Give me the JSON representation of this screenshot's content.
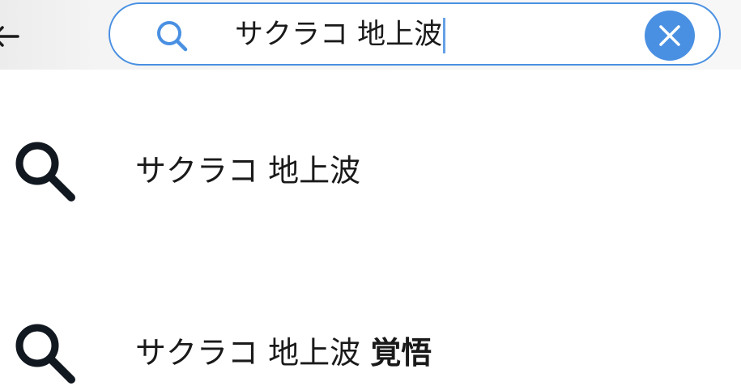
{
  "header": {
    "back_icon": "arrow-left-icon",
    "search": {
      "icon": "search-icon",
      "value": "サクラコ 地上波",
      "clear_icon": "close-icon",
      "accent_color": "#4a90e2"
    }
  },
  "suggestions": [
    {
      "icon": "search-icon",
      "text": "サクラコ 地上波",
      "bold": ""
    },
    {
      "icon": "search-icon",
      "text": "サクラコ 地上波",
      "bold": "覚悟"
    }
  ]
}
